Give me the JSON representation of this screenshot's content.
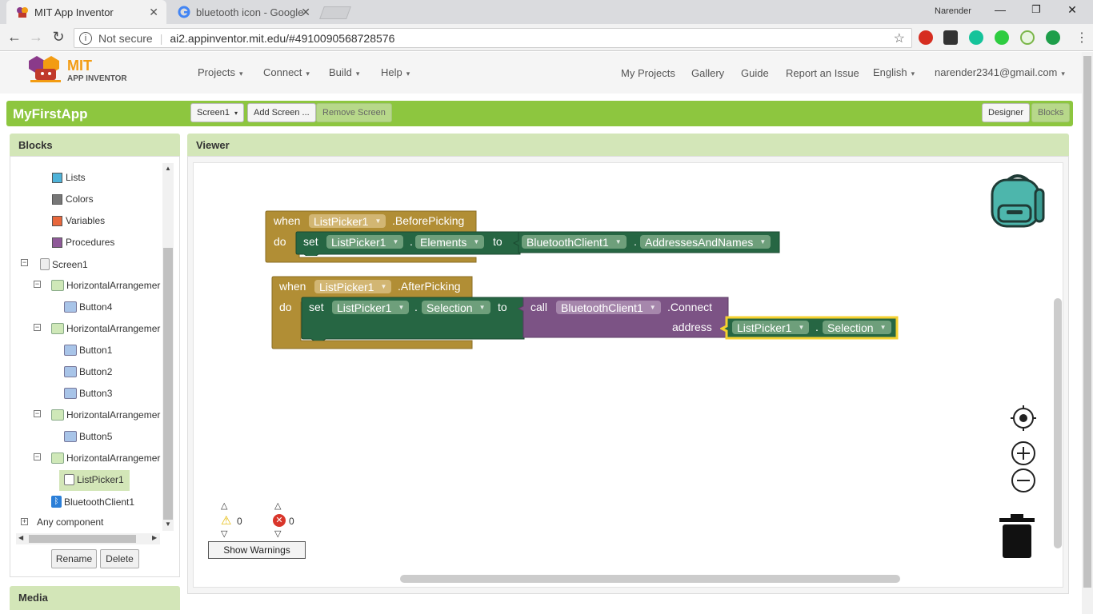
{
  "browser": {
    "tabs": [
      {
        "title": "MIT App Inventor",
        "active": true
      },
      {
        "title": "bluetooth icon - Google",
        "active": false
      }
    ],
    "profile": "Narender",
    "security": "Not secure",
    "url": "ai2.appinventor.mit.edu/#4910090568728576"
  },
  "app": {
    "logo_top": "MIT",
    "logo_bottom": "APP INVENTOR",
    "menus": [
      "Projects",
      "Connect",
      "Build",
      "Help"
    ],
    "links": [
      "My Projects",
      "Gallery",
      "Guide",
      "Report an Issue"
    ],
    "language": "English",
    "account": "narender2341@gmail.com"
  },
  "project": {
    "name": "MyFirstApp",
    "screen": "Screen1",
    "add_screen": "Add Screen ...",
    "remove_screen": "Remove Screen",
    "designer": "Designer",
    "blocks": "Blocks"
  },
  "blocks_panel": {
    "title": "Blocks",
    "builtins": [
      "Lists",
      "Colors",
      "Variables",
      "Procedures"
    ],
    "tree": {
      "screen": "Screen1",
      "h1": "HorizontalArrangemer",
      "b4": "Button4",
      "h2": "HorizontalArrangemer",
      "b1": "Button1",
      "b2": "Button2",
      "b3": "Button3",
      "h3": "HorizontalArrangemer",
      "b5": "Button5",
      "h4": "HorizontalArrangemer",
      "lp": "ListPicker1",
      "bt": "BluetoothClient1"
    },
    "any_component": "Any component",
    "rename": "Rename",
    "delete": "Delete"
  },
  "media_panel": {
    "title": "Media"
  },
  "viewer": {
    "title": "Viewer",
    "warnings_count": "0",
    "errors_count": "0",
    "show_warnings": "Show Warnings"
  },
  "block1": {
    "when": "when",
    "component": "ListPicker1",
    "event": ".BeforePicking",
    "do": "do",
    "set": "set",
    "set_component": "ListPicker1",
    "dot": ".",
    "property": "Elements",
    "to": "to",
    "getter_component": "BluetoothClient1",
    "getter_dot": ".",
    "getter_property": "AddressesAndNames"
  },
  "block2": {
    "when": "when",
    "component": "ListPicker1",
    "event": ".AfterPicking",
    "do": "do",
    "set": "set",
    "set_component": "ListPicker1",
    "dot": ".",
    "property": "Selection",
    "to": "to",
    "call": "call",
    "call_component": "BluetoothClient1",
    "method": ".Connect",
    "arg": "address",
    "arg_component": "ListPicker1",
    "arg_dot": ".",
    "arg_property": "Selection"
  },
  "colors": {
    "event": "#b18e35",
    "setter": "#266643",
    "method": "#7c5385",
    "apphead": "#f5f5f5",
    "greenbar": "#8dc63f",
    "panel_head": "#d3e6b8"
  }
}
